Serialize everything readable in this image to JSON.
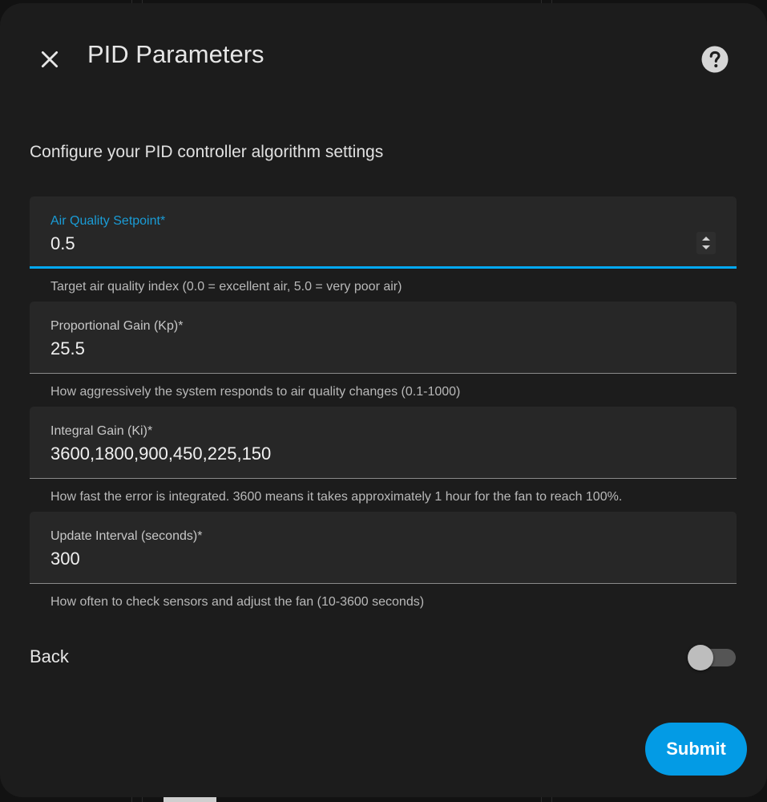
{
  "dialog": {
    "title": "PID Parameters",
    "close_icon": "close-icon",
    "help_icon": "help-circle-icon",
    "description": "Configure your PID controller algorithm settings"
  },
  "fields": [
    {
      "label": "Air Quality Setpoint*",
      "value": "0.5",
      "helper": "Target air quality index (0.0 = excellent air, 5.0 = very poor air)",
      "focused": true,
      "spinner": true
    },
    {
      "label": "Proportional Gain (Kp)*",
      "value": "25.5",
      "helper": "How aggressively the system responds to air quality changes (0.1-1000)"
    },
    {
      "label": "Integral Gain (Ki)*",
      "value": "3600,1800,900,450,225,150",
      "helper": "How fast the error is integrated. 3600 means it takes approximately 1 hour for the fan to reach 100%."
    },
    {
      "label": "Update Interval (seconds)*",
      "value": "300",
      "helper": "How often to check sensors and adjust the fan (10-3600 seconds)"
    }
  ],
  "back": {
    "label": "Back",
    "toggle_on": false
  },
  "submit": {
    "label": "Submit"
  },
  "colors": {
    "accent": "#03a9f4",
    "button": "#039be5",
    "surface": "#1c1c1c",
    "field": "#272727"
  }
}
